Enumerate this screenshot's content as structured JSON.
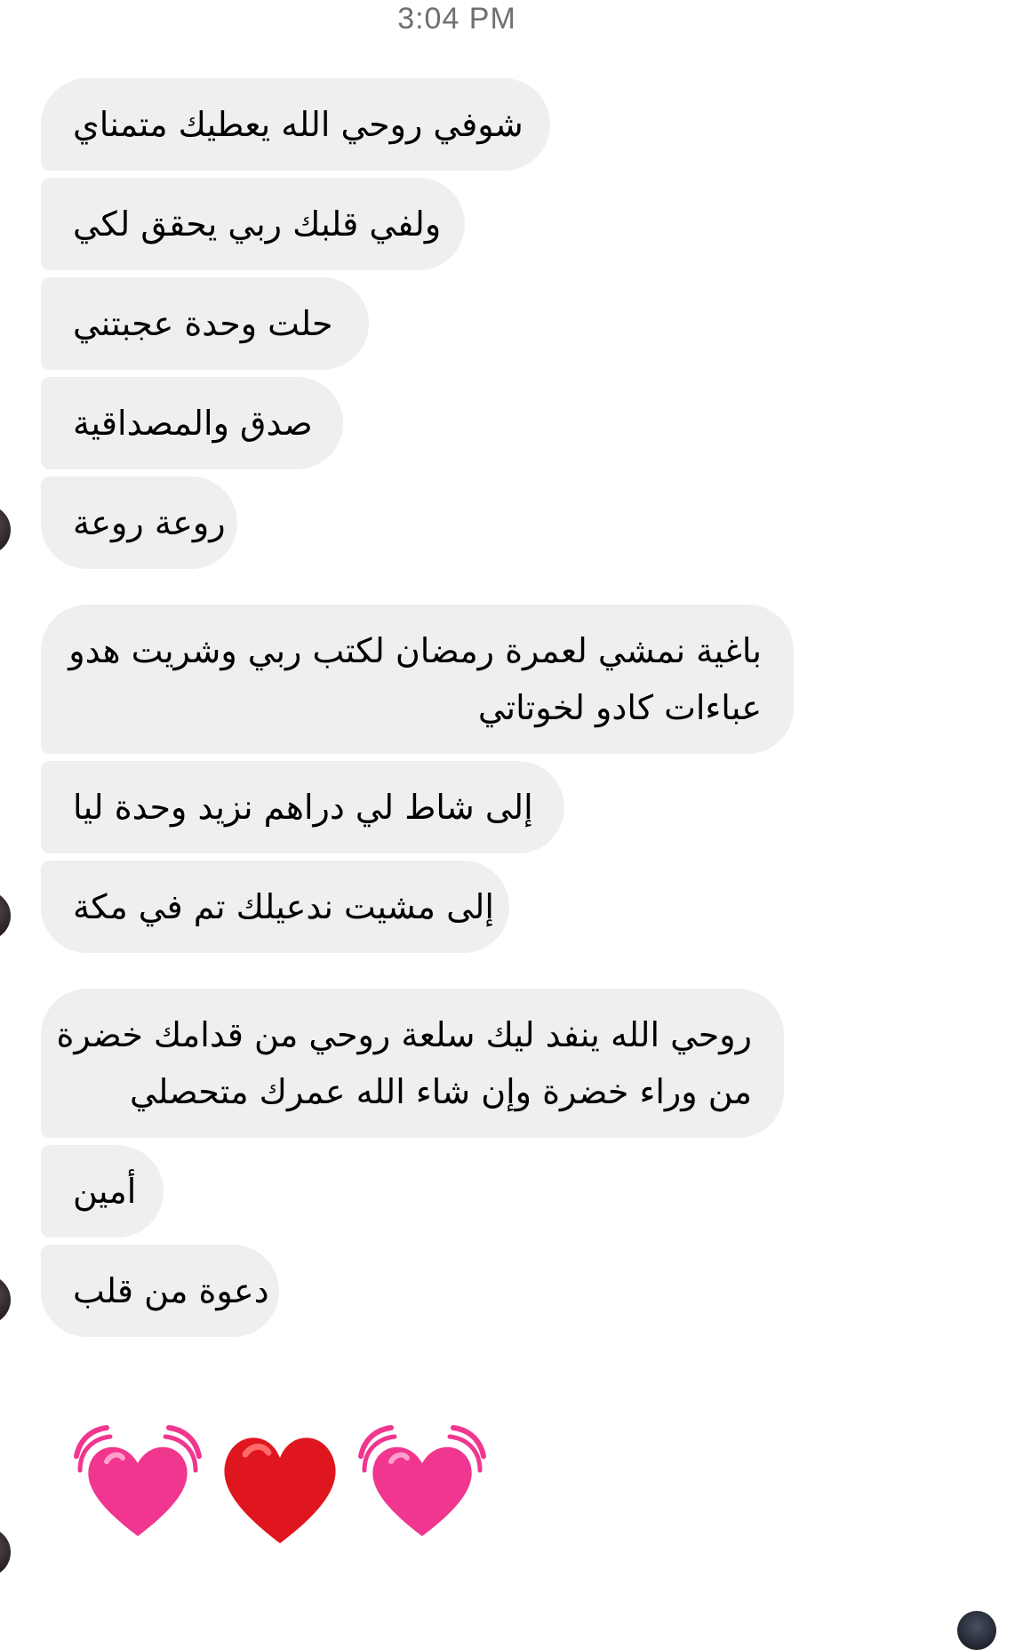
{
  "chat": {
    "timestamp": "3:04 PM",
    "messages": [
      {
        "lines": [
          "شوفي روحي الله يعطيك متمناي"
        ]
      },
      {
        "lines": [
          "ولفي قلبك ربي يحقق لكي"
        ]
      },
      {
        "lines": [
          "حلت وحدة عجبتني"
        ]
      },
      {
        "lines": [
          "صدق والمصداقية"
        ]
      },
      {
        "lines": [
          "روعة روعة"
        ]
      },
      {
        "lines": [
          "باغية نمشي لعمرة رمضان لكتب ربي وشريت هدو",
          "عباءات كادو لخوتاتي"
        ]
      },
      {
        "lines": [
          "إلى شاط لي دراهم نزيد وحدة ليا"
        ]
      },
      {
        "lines": [
          "إلى مشيت ندعيلك تم في مكة"
        ]
      },
      {
        "lines": [
          "روحي الله ينفد ليك سلعة روحي من قدامك خضرة",
          "من وراء خضرة وإن شاء الله عمرك متحصلي"
        ]
      },
      {
        "lines": [
          "أمين"
        ]
      },
      {
        "lines": [
          "دعوة من قلب"
        ]
      }
    ],
    "emoji_reaction": [
      "beating-heart-emoji",
      "red-heart-emoji",
      "beating-heart-emoji"
    ],
    "colors": {
      "incoming_bubble": "#efeff1",
      "timestamp_text": "#707070",
      "pink_heart": "#f0368f",
      "red_heart": "#e0161f"
    }
  }
}
